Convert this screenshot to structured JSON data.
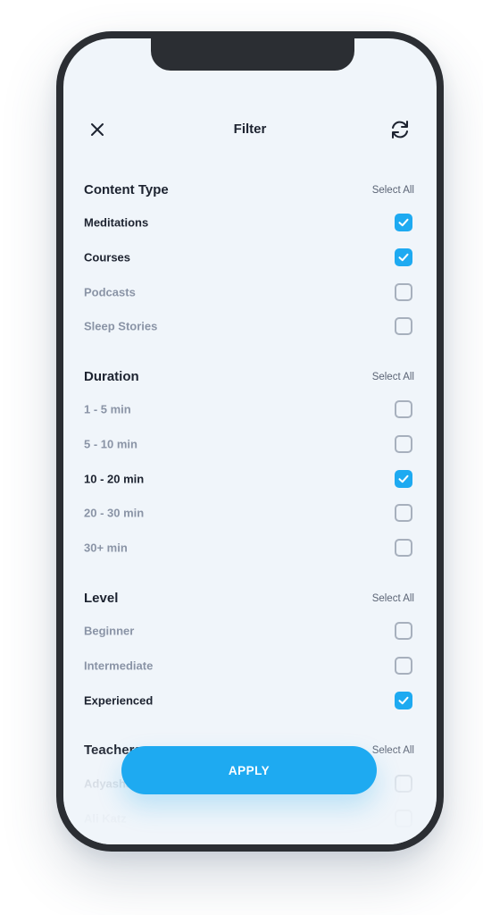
{
  "header": {
    "title": "Filter",
    "close_icon": "close-icon",
    "reset_icon": "refresh-icon"
  },
  "sections": [
    {
      "title": "Content Type",
      "select_all": "Select All",
      "options": [
        {
          "label": "Meditations",
          "checked": true
        },
        {
          "label": "Courses",
          "checked": true
        },
        {
          "label": "Podcasts",
          "checked": false
        },
        {
          "label": "Sleep Stories",
          "checked": false
        }
      ]
    },
    {
      "title": "Duration",
      "select_all": "Select All",
      "options": [
        {
          "label": "1 - 5 min",
          "checked": false
        },
        {
          "label": "5 - 10 min",
          "checked": false
        },
        {
          "label": "10 - 20 min",
          "checked": true
        },
        {
          "label": "20 - 30 min",
          "checked": false
        },
        {
          "label": "30+ min",
          "checked": false
        }
      ]
    },
    {
      "title": "Level",
      "select_all": "Select All",
      "options": [
        {
          "label": "Beginner",
          "checked": false
        },
        {
          "label": "Intermediate",
          "checked": false
        },
        {
          "label": "Experienced",
          "checked": true
        }
      ]
    },
    {
      "title": "Teachers",
      "select_all": "Select All",
      "options": [
        {
          "label": "Adyashanti",
          "checked": false
        },
        {
          "label": "Ali Katz",
          "checked": false
        }
      ]
    }
  ],
  "apply_button": "APPLY",
  "colors": {
    "accent": "#1eaaf1",
    "background": "#f0f5fa",
    "text_primary": "#1d2330",
    "text_muted": "#8a94a6",
    "checkbox_border": "#a7b0bd",
    "device_frame": "#2b2e33"
  }
}
